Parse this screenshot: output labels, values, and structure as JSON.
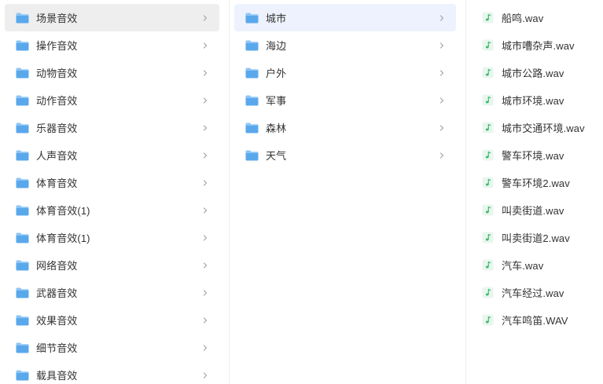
{
  "colors": {
    "folder": "#5aa8ec",
    "folder_tab": "#8ec5f5",
    "audio_icon_bg": "#e8f6ee",
    "audio_icon_note": "#3dba6b",
    "chevron": "#9aa0a6",
    "selected_col1": "#eeeeef",
    "selected_col2": "#eef2fe"
  },
  "icons": {
    "folder": "folder-icon",
    "audio": "audio-file-icon",
    "chevron": "chevron-right-icon"
  },
  "categories": {
    "selected_index": 0,
    "items": [
      {
        "label": "场景音效"
      },
      {
        "label": "操作音效"
      },
      {
        "label": "动物音效"
      },
      {
        "label": "动作音效"
      },
      {
        "label": "乐器音效"
      },
      {
        "label": "人声音效"
      },
      {
        "label": "体育音效"
      },
      {
        "label": "体育音效(1)"
      },
      {
        "label": "体育音效(1)"
      },
      {
        "label": "网络音效"
      },
      {
        "label": "武器音效"
      },
      {
        "label": "效果音效"
      },
      {
        "label": "细节音效"
      },
      {
        "label": "载具音效"
      }
    ]
  },
  "subcategories": {
    "selected_index": 0,
    "items": [
      {
        "label": "城市"
      },
      {
        "label": "海边"
      },
      {
        "label": "户外"
      },
      {
        "label": "军事"
      },
      {
        "label": "森林"
      },
      {
        "label": "天气"
      }
    ]
  },
  "files": {
    "items": [
      {
        "label": "船鸣.wav"
      },
      {
        "label": "城市嘈杂声.wav"
      },
      {
        "label": "城市公路.wav"
      },
      {
        "label": "城市环境.wav"
      },
      {
        "label": "城市交通环境.wav"
      },
      {
        "label": "警车环境.wav"
      },
      {
        "label": "警车环境2.wav"
      },
      {
        "label": "叫卖街道.wav"
      },
      {
        "label": "叫卖街道2.wav"
      },
      {
        "label": "汽车.wav"
      },
      {
        "label": "汽车经过.wav"
      },
      {
        "label": "汽车鸣笛.WAV"
      }
    ]
  }
}
